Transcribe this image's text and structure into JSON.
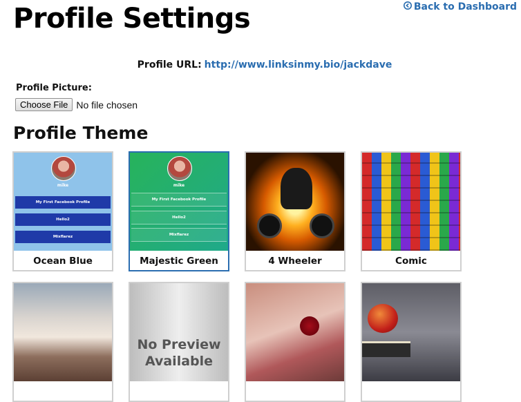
{
  "header": {
    "title": "Profile Settings",
    "back_link": "Back to Dashboard",
    "back_icon": "arrow-left-circle-icon"
  },
  "profile_url": {
    "label": "Profile URL:",
    "value": "http://www.linksinmy.bio/jackdave"
  },
  "profile_picture": {
    "label": "Profile Picture:",
    "button_label": "Choose File",
    "status": "No file chosen"
  },
  "theme_section": {
    "heading": "Profile Theme",
    "selected": "Majestic Green",
    "preview_sample": {
      "name": "mike",
      "links": [
        "My First Facebook Profile",
        "Hello2",
        "Mixflarez"
      ]
    },
    "no_preview_text": "No Preview Available",
    "themes": [
      {
        "label": "Ocean Blue"
      },
      {
        "label": "Majestic Green"
      },
      {
        "label": "4 Wheeler"
      },
      {
        "label": "Comic"
      },
      {
        "label": ""
      },
      {
        "label": ""
      },
      {
        "label": ""
      },
      {
        "label": ""
      }
    ]
  },
  "colors": {
    "link": "#2a6db0",
    "ocean_bg": "#8fc3ea",
    "ocean_button": "#1f3aa8",
    "green_bg": "#27b35b",
    "selected_border": "#2a6db0"
  }
}
